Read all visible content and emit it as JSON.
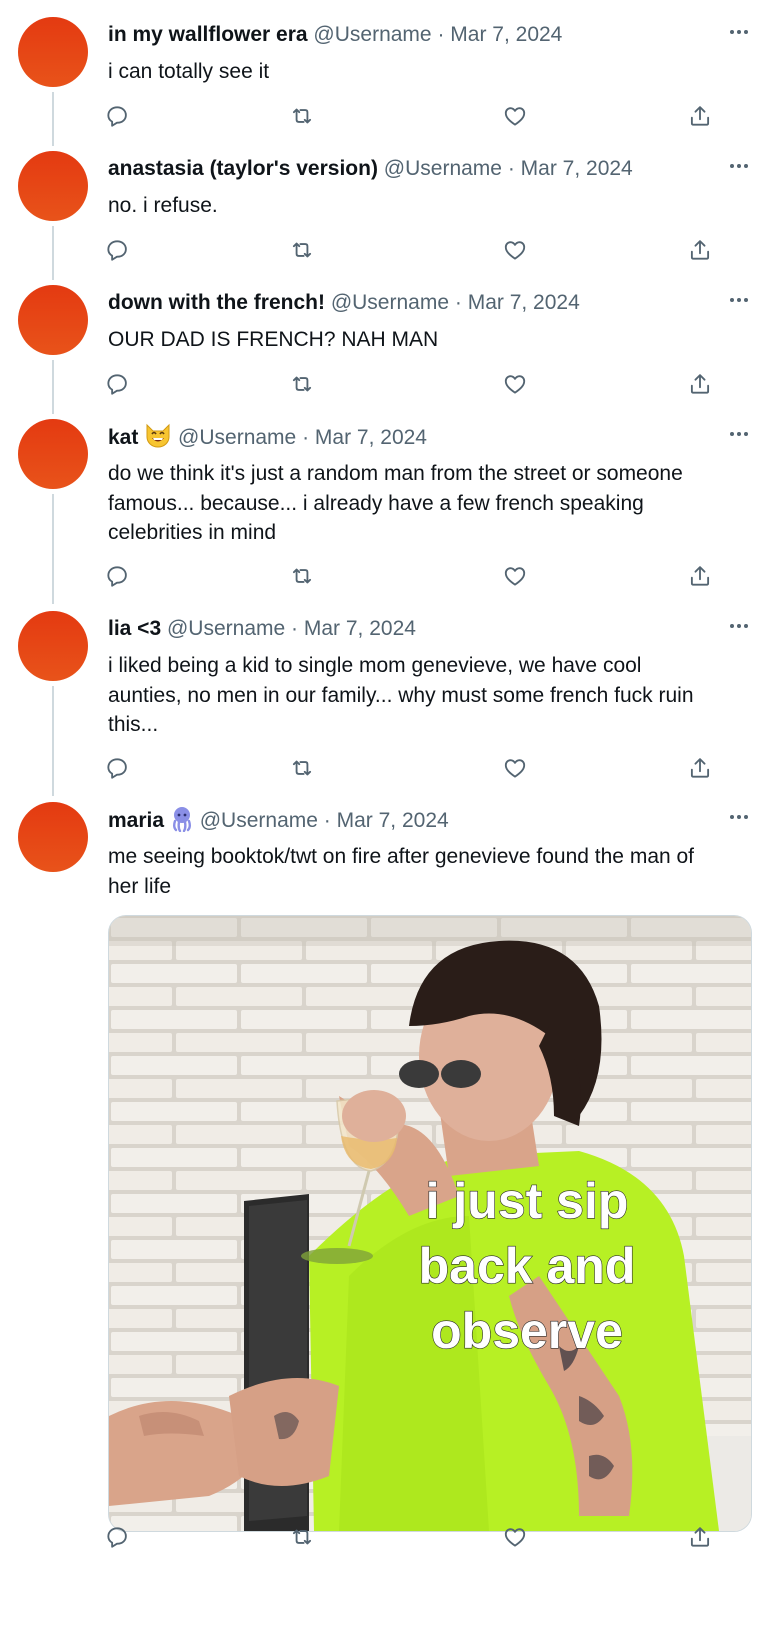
{
  "tweets": [
    {
      "name": "in my wallflower era",
      "handle": "@Username",
      "sep": "·",
      "date": "Mar 7, 2024",
      "lines": [
        "i can totally see it"
      ]
    },
    {
      "name": "anastasia (taylor's version)",
      "handle": "@Username",
      "sep": "·",
      "date": "Mar 7, 2024",
      "lines": [
        "no. i refuse."
      ]
    },
    {
      "name": "down with the french!",
      "handle": "@Username",
      "sep": "·",
      "date": "Mar 7, 2024",
      "lines": [
        "OUR DAD IS FRENCH? NAH MAN"
      ]
    },
    {
      "name": "kat",
      "name_emoji": "grinning-cat-emoji",
      "handle": "@Username",
      "sep": "·",
      "date": "Mar 7, 2024",
      "lines": [
        "do we think it's just a random man from the street or someone",
        "famous... because... i already have a few french speaking",
        "celebrities in mind"
      ]
    },
    {
      "name": "lia <3",
      "handle": "@Username",
      "sep": "·",
      "date": "Mar 7, 2024",
      "lines": [
        "i liked being a kid to single mom genevieve, we have cool",
        "aunties, no men in our family... why must some french fuck ruin",
        "this..."
      ]
    },
    {
      "name": "maria",
      "name_emoji": "octopus-emoji",
      "handle": "@Username",
      "sep": "·",
      "date": "Mar 7, 2024",
      "lines": [
        "me seeing booktok/twt on fire after genevieve found the man of",
        "her life"
      ],
      "media": {
        "caption_lines": [
          "i just sip",
          "back and",
          "observe"
        ],
        "icon": "meme-photo"
      }
    }
  ],
  "icons": {
    "reply": "reply-icon",
    "retweet": "retweet-icon",
    "like": "like-icon",
    "share": "share-icon",
    "more": "more-icon"
  },
  "colors": {
    "avatar": "#e43a11",
    "muted": "#536471",
    "text": "#0f1419",
    "thread": "#cfd9de"
  }
}
